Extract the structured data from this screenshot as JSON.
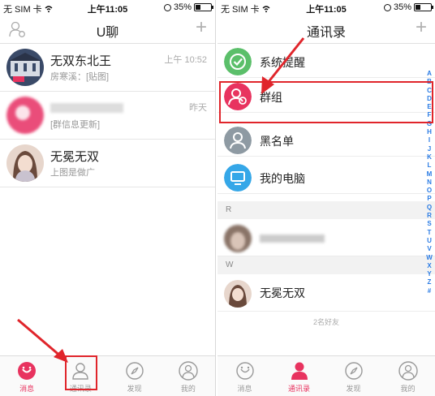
{
  "status_bar": {
    "carrier": "无 SIM 卡",
    "time": "上午11:05",
    "battery_percent": "35%",
    "battery_level": 0.35
  },
  "left_screen": {
    "nav": {
      "title": "U聊",
      "plus": "+"
    },
    "chats": [
      {
        "name": "无双东北王",
        "preview": "房寒溪：[贴图]",
        "time": "上午 10:52"
      },
      {
        "name": "",
        "preview": "[群信息更新]",
        "time": "昨天"
      },
      {
        "name": "无冕无双",
        "preview": "上图是做广",
        "time": ""
      }
    ],
    "tabs": [
      {
        "label": "消息",
        "icon": "message-icon"
      },
      {
        "label": "通讯录",
        "icon": "contacts-icon"
      },
      {
        "label": "发现",
        "icon": "compass-icon"
      },
      {
        "label": "我的",
        "icon": "profile-icon"
      }
    ]
  },
  "right_screen": {
    "nav": {
      "title": "通讯录",
      "plus": "+"
    },
    "rows": [
      {
        "label": "系统提醒",
        "icon": "system-reminder-icon"
      },
      {
        "label": "群组",
        "icon": "group-icon"
      },
      {
        "label": "黑名单",
        "icon": "blacklist-icon"
      },
      {
        "label": "我的电脑",
        "icon": "computer-icon"
      }
    ],
    "sections": [
      {
        "letter": "R",
        "contacts": [
          {
            "name": ""
          }
        ]
      },
      {
        "letter": "W",
        "contacts": [
          {
            "name": "无冕无双"
          }
        ]
      }
    ],
    "friend_count": "2名好友",
    "index_letters": [
      "A",
      "B",
      "C",
      "D",
      "E",
      "F",
      "G",
      "H",
      "I",
      "J",
      "K",
      "L",
      "M",
      "N",
      "O",
      "P",
      "Q",
      "R",
      "S",
      "T",
      "U",
      "V",
      "W",
      "X",
      "Y",
      "Z",
      "#"
    ],
    "tabs": [
      {
        "label": "消息",
        "icon": "message-icon"
      },
      {
        "label": "通讯录",
        "icon": "contacts-icon"
      },
      {
        "label": "发现",
        "icon": "compass-icon"
      },
      {
        "label": "我的",
        "icon": "profile-icon"
      }
    ]
  },
  "colors": {
    "accent": "#e8335f",
    "highlight": "#e0252b",
    "index": "#2a7be4",
    "green": "#5bbf6a",
    "gray": "#8e9aa3",
    "blue": "#35a7e8"
  }
}
